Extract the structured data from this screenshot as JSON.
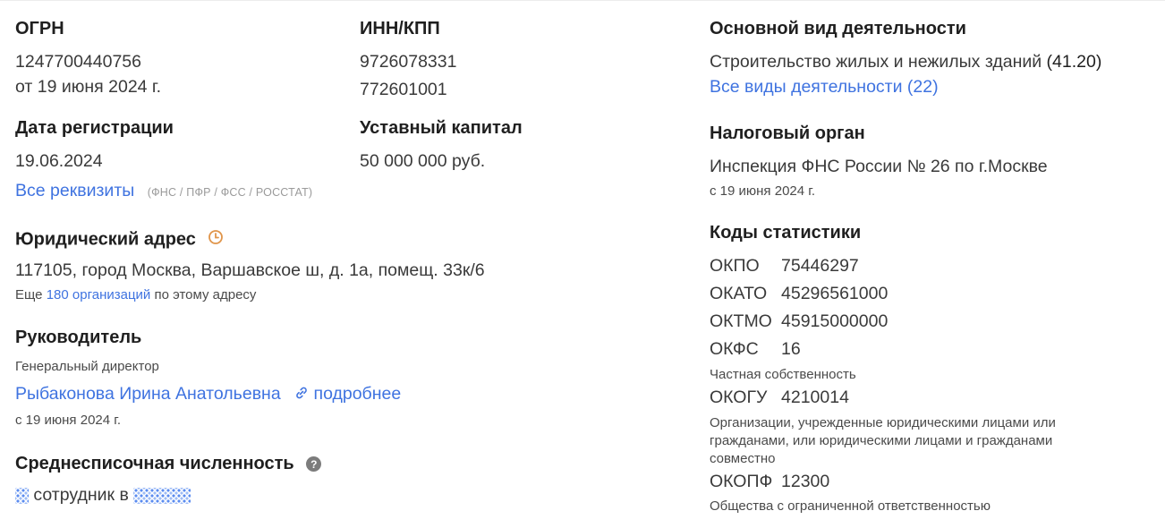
{
  "colors": {
    "link": "#3f73e0",
    "heading": "#1f1f1f",
    "text": "#3a3a3a",
    "muted": "#9a9a9a",
    "clock": "#e0954a"
  },
  "ogrn": {
    "label": "ОГРН",
    "value": "1247700440756",
    "date": "от 19 июня 2024 г."
  },
  "inn_kpp": {
    "label": "ИНН/КПП",
    "inn": "9726078331",
    "kpp": "772601001"
  },
  "reg_date": {
    "label": "Дата регистрации",
    "value": "19.06.2024"
  },
  "capital": {
    "label": "Уставный капитал",
    "value": "50 000 000 руб."
  },
  "requisites": {
    "link": "Все реквизиты",
    "note": "(ФНС / ПФР / ФСС / РОССТАТ)"
  },
  "address": {
    "label": "Юридический адрес",
    "icon": "clock-icon",
    "value": "117105, город Москва, Варшавское ш, д. 1а, помещ. 33к/6",
    "more_prefix": "Еще",
    "more_link": "180 организаций",
    "more_suffix": "по этому адресу"
  },
  "director": {
    "label": "Руководитель",
    "position": "Генеральный директор",
    "name": "Рыбаконова Ирина Анатольевна",
    "details_icon": "link-icon",
    "details": "подробнее",
    "since": "с 19 июня 2024 г."
  },
  "headcount": {
    "label": "Среднесписочная численность",
    "icon": "question-icon",
    "text": "сотрудник в"
  },
  "activity": {
    "label": "Основной вид деятельности",
    "value": "Строительство жилых и нежилых зданий",
    "code": "(41.20)",
    "all_link": "Все виды деятельности (22)"
  },
  "tax": {
    "label": "Налоговый орган",
    "value": "Инспекция ФНС России № 26 по г.Москве",
    "since": "с 19 июня 2024 г."
  },
  "stats": {
    "label": "Коды статистики",
    "codes": [
      {
        "name": "ОКПО",
        "value": "75446297",
        "desc": ""
      },
      {
        "name": "ОКАТО",
        "value": "45296561000",
        "desc": ""
      },
      {
        "name": "ОКТМО",
        "value": "45915000000",
        "desc": ""
      },
      {
        "name": "ОКФС",
        "value": "16",
        "desc": "Частная собственность"
      },
      {
        "name": "ОКОГУ",
        "value": "4210014",
        "desc": "Организации, учрежденные юридическими лицами или гражданами, или юридическими лицами и гражданами совместно"
      },
      {
        "name": "ОКОПФ",
        "value": "12300",
        "desc": "Общества с ограниченной ответственностью"
      }
    ]
  }
}
